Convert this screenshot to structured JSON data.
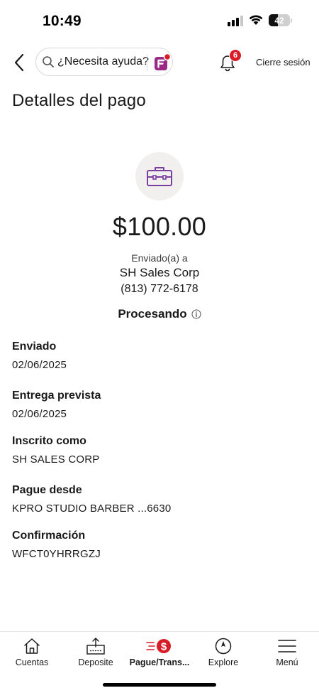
{
  "status_bar": {
    "time": "10:49",
    "battery": "42",
    "battery_level": 0.42
  },
  "header": {
    "search_placeholder": "¿Necesita ayuda?",
    "notification_count": "6",
    "signout_label": "Cierre sesión"
  },
  "page": {
    "title": "Detalles del pago"
  },
  "payment": {
    "amount": "$100.00",
    "sent_to_label": "Enviado(a) a",
    "payee_name": "SH Sales Corp",
    "payee_phone": "(813) 772-6178",
    "status": "Procesando"
  },
  "details": [
    {
      "label": "Enviado",
      "value": "02/06/2025"
    },
    {
      "label": "Entrega prevista",
      "value": "02/06/2025"
    },
    {
      "label": "Inscrito como",
      "value": "SH SALES CORP"
    },
    {
      "label": "Pague desde",
      "value": "KPRO STUDIO BARBER ...6630"
    },
    {
      "label": "Confirmación",
      "value": "WFCT0YHRRGZJ"
    }
  ],
  "bottom_nav": [
    {
      "label": "Cuentas",
      "icon": "home-icon"
    },
    {
      "label": "Deposite",
      "icon": "deposit-icon"
    },
    {
      "label": "Pague/Trans...",
      "icon": "pay-transfer-icon",
      "active": true
    },
    {
      "label": "Explore",
      "icon": "compass-icon"
    },
    {
      "label": "Menú",
      "icon": "hamburger-menu-icon"
    }
  ],
  "colors": {
    "brand_red": "#d71e28",
    "accent_purple": "#7b3fa0",
    "fargo_magenta": "#9b2a87"
  }
}
